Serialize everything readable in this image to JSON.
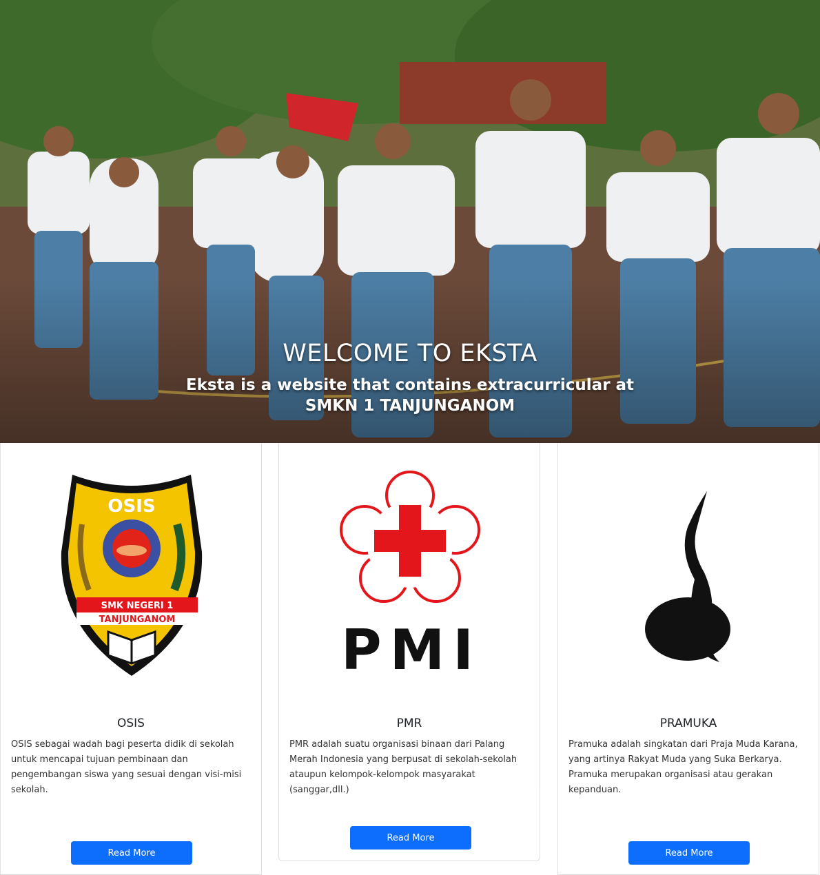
{
  "hero": {
    "title": "WELCOME TO EKSTA",
    "subtitle": "Eksta is a website that contains extracurricular at SMKN 1 TANJUNGANOM"
  },
  "cards": [
    {
      "logo": {
        "icon": "osis-emblem-icon",
        "top_text": "OSIS",
        "band_line1": "SMK NEGERI 1",
        "band_line2": "TANJUNGANOM"
      },
      "title": "OSIS",
      "text": "OSIS sebagai wadah bagi peserta didik di sekolah untuk mencapai tujuan pembinaan dan pengembangan siswa yang sesuai dengan visi-misi sekolah.",
      "button": "Read More"
    },
    {
      "logo": {
        "icon": "pmi-red-cross-icon",
        "wordmark": "PMI"
      },
      "title": "PMR",
      "text": "PMR adalah suatu organisasi binaan dari Palang Merah Indonesia yang berpusat di sekolah-sekolah ataupun kelompok-kelompok masyarakat (sanggar,dll.)",
      "button": "Read More"
    },
    {
      "logo": {
        "icon": "tunas-kelapa-icon"
      },
      "title": "PRAMUKA",
      "text": "Pramuka adalah singkatan dari Praja Muda Karana, yang artinya Rakyat Muda yang Suka Berkarya. Pramuka merupakan organisasi atau gerakan kepanduan.",
      "button": "Read More"
    }
  ],
  "colors": {
    "primary": "#0d6efd",
    "shield_yellow": "#f5c400",
    "red": "#e3161b"
  }
}
